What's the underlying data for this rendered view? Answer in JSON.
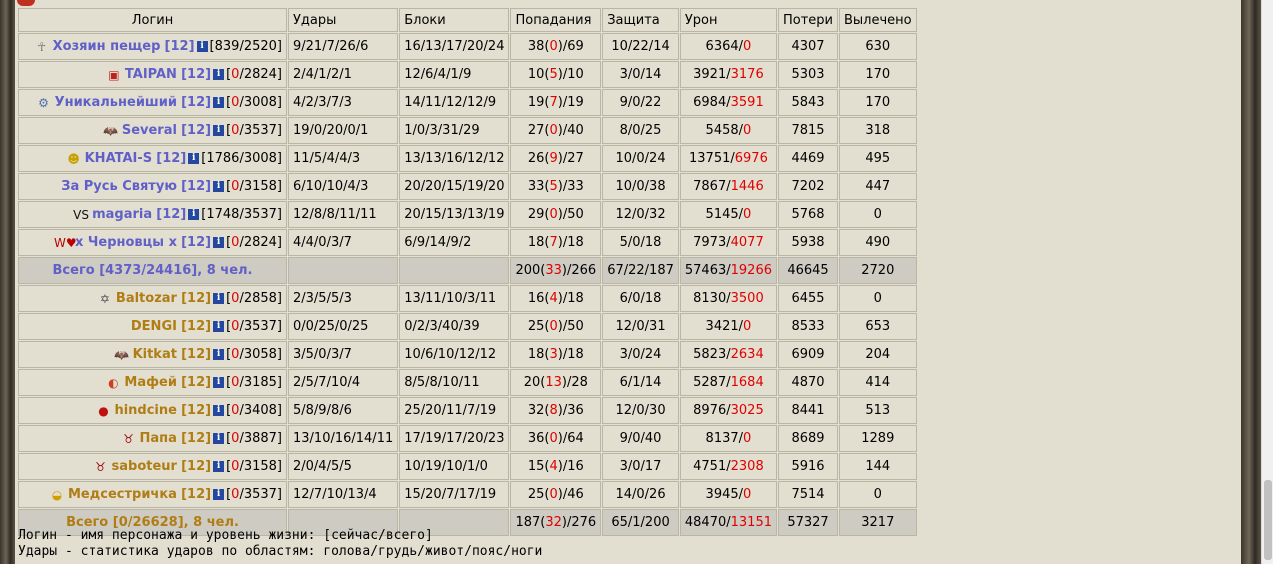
{
  "headers": [
    "Логин",
    "Удары",
    "Блоки",
    "Попадания",
    "Защита",
    "Урон",
    "Потери",
    "Вылечено"
  ],
  "team1": {
    "rows": [
      {
        "icon": "angel-icon",
        "name": "Хозяин пещер",
        "level": "[12]",
        "hp_cur": "839",
        "hp_max": "2520",
        "hits": "9/21/7/26/6",
        "blocks": "16/13/17/20/24",
        "acc_a": "38",
        "acc_b": "0",
        "acc_c": "69",
        "def": "10/22/14",
        "dmg_a": "6364",
        "dmg_b": "0",
        "loss": "4307",
        "heal": "630"
      },
      {
        "icon": "flag-icon",
        "name": "TAIPAN",
        "level": "[12]",
        "hp_cur": "0",
        "hp_max": "2824",
        "hits": "2/4/1/2/1",
        "blocks": "12/6/4/1/9",
        "acc_a": "10",
        "acc_b": "5",
        "acc_c": "10",
        "def": "3/0/14",
        "dmg_a": "3921",
        "dmg_b": "3176",
        "loss": "5303",
        "heal": "170"
      },
      {
        "icon": "helmet-icon",
        "name": "Уникальнейший",
        "level": "[12]",
        "hp_cur": "0",
        "hp_max": "3008",
        "hits": "4/2/3/7/3",
        "blocks": "14/11/12/12/9",
        "acc_a": "19",
        "acc_b": "7",
        "acc_c": "19",
        "def": "9/0/22",
        "dmg_a": "6984",
        "dmg_b": "3591",
        "loss": "5843",
        "heal": "170"
      },
      {
        "icon": "bat-icon",
        "name": "Several",
        "level": "[12]",
        "hp_cur": "0",
        "hp_max": "3537",
        "hits": "19/0/20/0/1",
        "blocks": "1/0/3/31/29",
        "acc_a": "27",
        "acc_b": "0",
        "acc_c": "40",
        "def": "8/0/25",
        "dmg_a": "5458",
        "dmg_b": "0",
        "loss": "7815",
        "heal": "318"
      },
      {
        "icon": "smiley-icon",
        "name": "KHATAI-S",
        "level": "[12]",
        "hp_cur": "1786",
        "hp_max": "3008",
        "hits": "11/5/4/4/3",
        "blocks": "13/13/16/12/12",
        "acc_a": "26",
        "acc_b": "9",
        "acc_c": "27",
        "def": "10/0/24",
        "dmg_a": "13751",
        "dmg_b": "6976",
        "loss": "4469",
        "heal": "495"
      },
      {
        "icon": "",
        "name": "За Русь Святую",
        "level": "[12]",
        "hp_cur": "0",
        "hp_max": "3158",
        "hits": "6/10/10/4/3",
        "blocks": "20/20/15/19/20",
        "acc_a": "33",
        "acc_b": "5",
        "acc_c": "33",
        "def": "10/0/38",
        "dmg_a": "7867",
        "dmg_b": "1446",
        "loss": "7202",
        "heal": "447"
      },
      {
        "icon": "vs-icon",
        "name": "magaria",
        "level": "[12]",
        "hp_cur": "1748",
        "hp_max": "3537",
        "hits": "12/8/8/11/11",
        "blocks": "20/15/13/13/19",
        "acc_a": "29",
        "acc_b": "0",
        "acc_c": "50",
        "def": "12/0/32",
        "dmg_a": "5145",
        "dmg_b": "0",
        "loss": "5768",
        "heal": "0"
      },
      {
        "icon": "w-heart-icon",
        "name": "х Черновцы х",
        "level": "[12]",
        "hp_cur": "0",
        "hp_max": "2824",
        "hits": "4/4/0/3/7",
        "blocks": "6/9/14/9/2",
        "acc_a": "18",
        "acc_b": "7",
        "acc_c": "18",
        "def": "5/0/18",
        "dmg_a": "7973",
        "dmg_b": "4077",
        "loss": "5938",
        "heal": "490"
      }
    ],
    "total": {
      "label": "Всего [4373/24416], 8 чел.",
      "acc_a": "200",
      "acc_b": "33",
      "acc_c": "266",
      "def": "67/22/187",
      "dmg_a": "57463",
      "dmg_b": "19266",
      "loss": "46645",
      "heal": "2720"
    }
  },
  "team2": {
    "rows": [
      {
        "icon": "star-of-david-icon",
        "name": "Baltozar",
        "level": "[12]",
        "hp_cur": "0",
        "hp_max": "2858",
        "hits": "2/3/5/5/3",
        "blocks": "13/11/10/3/11",
        "acc_a": "16",
        "acc_b": "4",
        "acc_c": "18",
        "def": "6/0/18",
        "dmg_a": "8130",
        "dmg_b": "3500",
        "loss": "6455",
        "heal": "0"
      },
      {
        "icon": "",
        "name": "DENGI",
        "level": "[12]",
        "hp_cur": "0",
        "hp_max": "3537",
        "hits": "0/0/25/0/25",
        "blocks": "0/2/3/40/39",
        "acc_a": "25",
        "acc_b": "0",
        "acc_c": "50",
        "def": "12/0/31",
        "dmg_a": "3421",
        "dmg_b": "0",
        "loss": "8533",
        "heal": "653"
      },
      {
        "icon": "bat-icon",
        "name": "Kitkat",
        "level": "[12]",
        "hp_cur": "0",
        "hp_max": "3058",
        "hits": "3/5/0/3/7",
        "blocks": "10/6/10/12/12",
        "acc_a": "18",
        "acc_b": "3",
        "acc_c": "18",
        "def": "3/0/24",
        "dmg_a": "5823",
        "dmg_b": "2634",
        "loss": "6909",
        "heal": "204"
      },
      {
        "icon": "rainbow-icon",
        "name": "Мафей",
        "level": "[12]",
        "hp_cur": "0",
        "hp_max": "3185",
        "hits": "2/5/7/10/4",
        "blocks": "8/5/8/10/11",
        "acc_a": "20",
        "acc_b": "13",
        "acc_c": "28",
        "def": "6/1/14",
        "dmg_a": "5287",
        "dmg_b": "1684",
        "loss": "4870",
        "heal": "414"
      },
      {
        "icon": "red-skull-icon",
        "name": "hindcine",
        "level": "[12]",
        "hp_cur": "0",
        "hp_max": "3408",
        "hits": "5/8/9/8/6",
        "blocks": "25/20/11/7/19",
        "acc_a": "32",
        "acc_b": "8",
        "acc_c": "36",
        "def": "12/0/30",
        "dmg_a": "8976",
        "dmg_b": "3025",
        "loss": "8441",
        "heal": "513"
      },
      {
        "icon": "bull-icon",
        "name": "Папа",
        "level": "[12]",
        "hp_cur": "0",
        "hp_max": "3887",
        "hits": "13/10/16/14/11",
        "blocks": "17/19/17/20/23",
        "acc_a": "36",
        "acc_b": "0",
        "acc_c": "64",
        "def": "9/0/40",
        "dmg_a": "8137",
        "dmg_b": "0",
        "loss": "8689",
        "heal": "1289"
      },
      {
        "icon": "bull-icon",
        "name": "saboteur",
        "level": "[12]",
        "hp_cur": "0",
        "hp_max": "3158",
        "hits": "2/0/4/5/5",
        "blocks": "10/19/10/1/0",
        "acc_a": "15",
        "acc_b": "4",
        "acc_c": "16",
        "def": "3/0/17",
        "dmg_a": "4751",
        "dmg_b": "2308",
        "loss": "5916",
        "heal": "144"
      },
      {
        "icon": "hardhat-icon",
        "name": "Медсестричка",
        "level": "[12]",
        "hp_cur": "0",
        "hp_max": "3537",
        "hits": "12/7/10/13/4",
        "blocks": "15/20/7/17/19",
        "acc_a": "25",
        "acc_b": "0",
        "acc_c": "46",
        "def": "14/0/26",
        "dmg_a": "3945",
        "dmg_b": "0",
        "loss": "7514",
        "heal": "0"
      }
    ],
    "total": {
      "label": "Всего [0/26628], 8 чел.",
      "acc_a": "187",
      "acc_b": "32",
      "acc_c": "276",
      "def": "65/1/200",
      "dmg_a": "48470",
      "dmg_b": "13151",
      "loss": "57327",
      "heal": "3217"
    }
  },
  "legend": [
    "Логин - имя персонажа и уровень жизни: [сейчас/всего]",
    "Удары - статистика ударов по областям: голова/грудь/живот/пояс/ноги"
  ]
}
